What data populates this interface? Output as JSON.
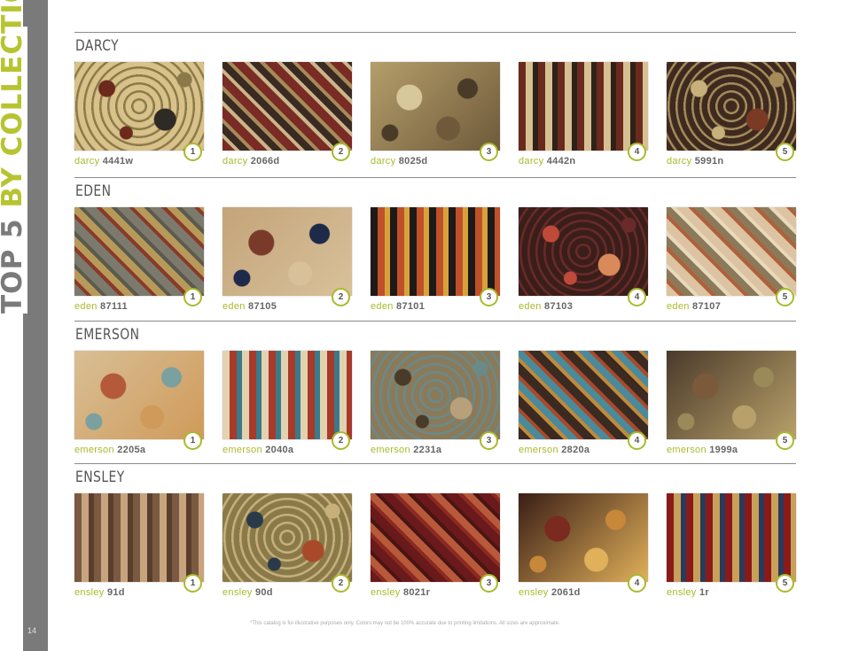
{
  "sidebar": {
    "title_part1": "TOP 5",
    "title_part2": "BY COLLECTION",
    "page_number": "14"
  },
  "colors": {
    "accent": "#a9ba2c",
    "sidebar_gray": "#7a7a7a"
  },
  "sections": [
    {
      "title": "DARCY",
      "items": [
        {
          "rank": "1",
          "collection": "darcy",
          "code": "4441w",
          "palette": [
            "#d9c18a",
            "#6b2a1c",
            "#2e2a25",
            "#8a7a4a"
          ]
        },
        {
          "rank": "2",
          "collection": "darcy",
          "code": "2066d",
          "palette": [
            "#7a2b24",
            "#c9b58a",
            "#3a2a22",
            "#a58b5a"
          ]
        },
        {
          "rank": "3",
          "collection": "darcy",
          "code": "8025d",
          "palette": [
            "#b59e6b",
            "#4a3b28",
            "#d7c79a",
            "#6e5a3a"
          ]
        },
        {
          "rank": "4",
          "collection": "darcy",
          "code": "4442n",
          "palette": [
            "#6a2a1d",
            "#d6c093",
            "#2e2218",
            "#9a3a22"
          ]
        },
        {
          "rank": "5",
          "collection": "darcy",
          "code": "5991n",
          "palette": [
            "#3e2a1f",
            "#c7b07a",
            "#7a3a24",
            "#a58b5a"
          ]
        }
      ]
    },
    {
      "title": "EDEN",
      "items": [
        {
          "rank": "1",
          "collection": "eden",
          "code": "87111",
          "palette": [
            "#7b7a6c",
            "#8a3a2a",
            "#b79a5a",
            "#5a5a4e"
          ]
        },
        {
          "rank": "2",
          "collection": "eden",
          "code": "87105",
          "palette": [
            "#c4a47a",
            "#1e2a4a",
            "#7a3a2a",
            "#d8c19a"
          ]
        },
        {
          "rank": "3",
          "collection": "eden",
          "code": "87101",
          "palette": [
            "#1d1a18",
            "#c0502a",
            "#d8a23a",
            "#2a5a6a"
          ]
        },
        {
          "rank": "4",
          "collection": "eden",
          "code": "87103",
          "palette": [
            "#3a1e1a",
            "#c04a3a",
            "#d88a5a",
            "#6a2a2a"
          ]
        },
        {
          "rank": "5",
          "collection": "eden",
          "code": "87107",
          "palette": [
            "#dcc3a2",
            "#b0603a",
            "#8a7a5a",
            "#e8d8bc"
          ]
        }
      ]
    },
    {
      "title": "EMERSON",
      "items": [
        {
          "rank": "1",
          "collection": "emerson",
          "code": "2205a",
          "palette": [
            "#d8bf95",
            "#7aa0a0",
            "#b45a3a",
            "#d09a5a"
          ]
        },
        {
          "rank": "2",
          "collection": "emerson",
          "code": "2040a",
          "palette": [
            "#e2d2b0",
            "#a83a2a",
            "#3a7a8a",
            "#d6a23a"
          ]
        },
        {
          "rank": "3",
          "collection": "emerson",
          "code": "2231a",
          "palette": [
            "#8a7a5a",
            "#4a3a2a",
            "#b8a07a",
            "#6a8a8a"
          ]
        },
        {
          "rank": "4",
          "collection": "emerson",
          "code": "2820a",
          "palette": [
            "#3a2a22",
            "#c08a3a",
            "#4a8a9a",
            "#a84a2a"
          ]
        },
        {
          "rank": "5",
          "collection": "emerson",
          "code": "1999a",
          "palette": [
            "#4a3a2a",
            "#9a8a5a",
            "#7a5a3a",
            "#b8a06a"
          ]
        }
      ]
    },
    {
      "title": "ENSLEY",
      "items": [
        {
          "rank": "1",
          "collection": "ensley",
          "code": "91d",
          "palette": [
            "#7a5a42",
            "#c8a47e",
            "#5a3e2c",
            "#b08a64"
          ]
        },
        {
          "rank": "2",
          "collection": "ensley",
          "code": "90d",
          "palette": [
            "#8a7a4a",
            "#2a3a4a",
            "#a84a2a",
            "#c8b07a"
          ]
        },
        {
          "rank": "3",
          "collection": "ensley",
          "code": "8021r",
          "palette": [
            "#6a1a1a",
            "#8a2a22",
            "#b85a3a",
            "#4a1414"
          ]
        },
        {
          "rank": "4",
          "collection": "ensley",
          "code": "2061d",
          "palette": [
            "#3a1e16",
            "#c8883a",
            "#7a2a1e",
            "#e0b05a"
          ]
        },
        {
          "rank": "5",
          "collection": "ensley",
          "code": "1r",
          "palette": [
            "#8a1a1a",
            "#c8a05a",
            "#2a3a5a",
            "#a02a22"
          ]
        }
      ]
    }
  ],
  "footnote": "*This catalog is for illustrative purposes only. Colors may not be 100% accurate due to printing limitations. All sizes are approximate."
}
